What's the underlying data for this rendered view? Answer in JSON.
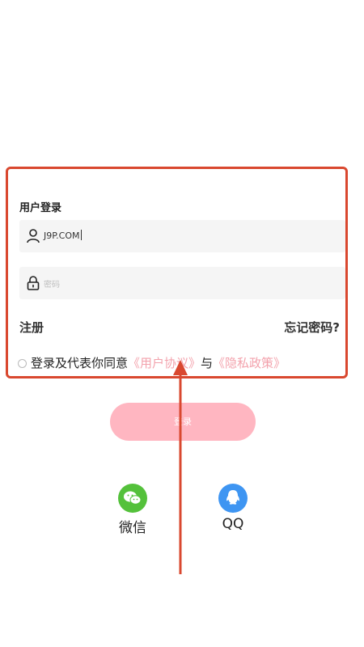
{
  "login": {
    "title": "用户登录",
    "username_value": "J9P.COM",
    "password_placeholder": "密码",
    "register_label": "注册",
    "forgot_label": "忘记密码?",
    "agreement_text": "登录及代表你同意",
    "user_agreement_link": "《用户协议》",
    "and_text": "与",
    "privacy_link": "《隐私政策》",
    "login_button": "登录"
  },
  "social": {
    "wechat_label": "微信",
    "qq_label": "QQ"
  },
  "colors": {
    "highlight_border": "#d9482f",
    "login_button": "#ffb6c1",
    "link": "#f3a2ac",
    "wechat": "#54c13b",
    "qq": "#3e95f2"
  }
}
